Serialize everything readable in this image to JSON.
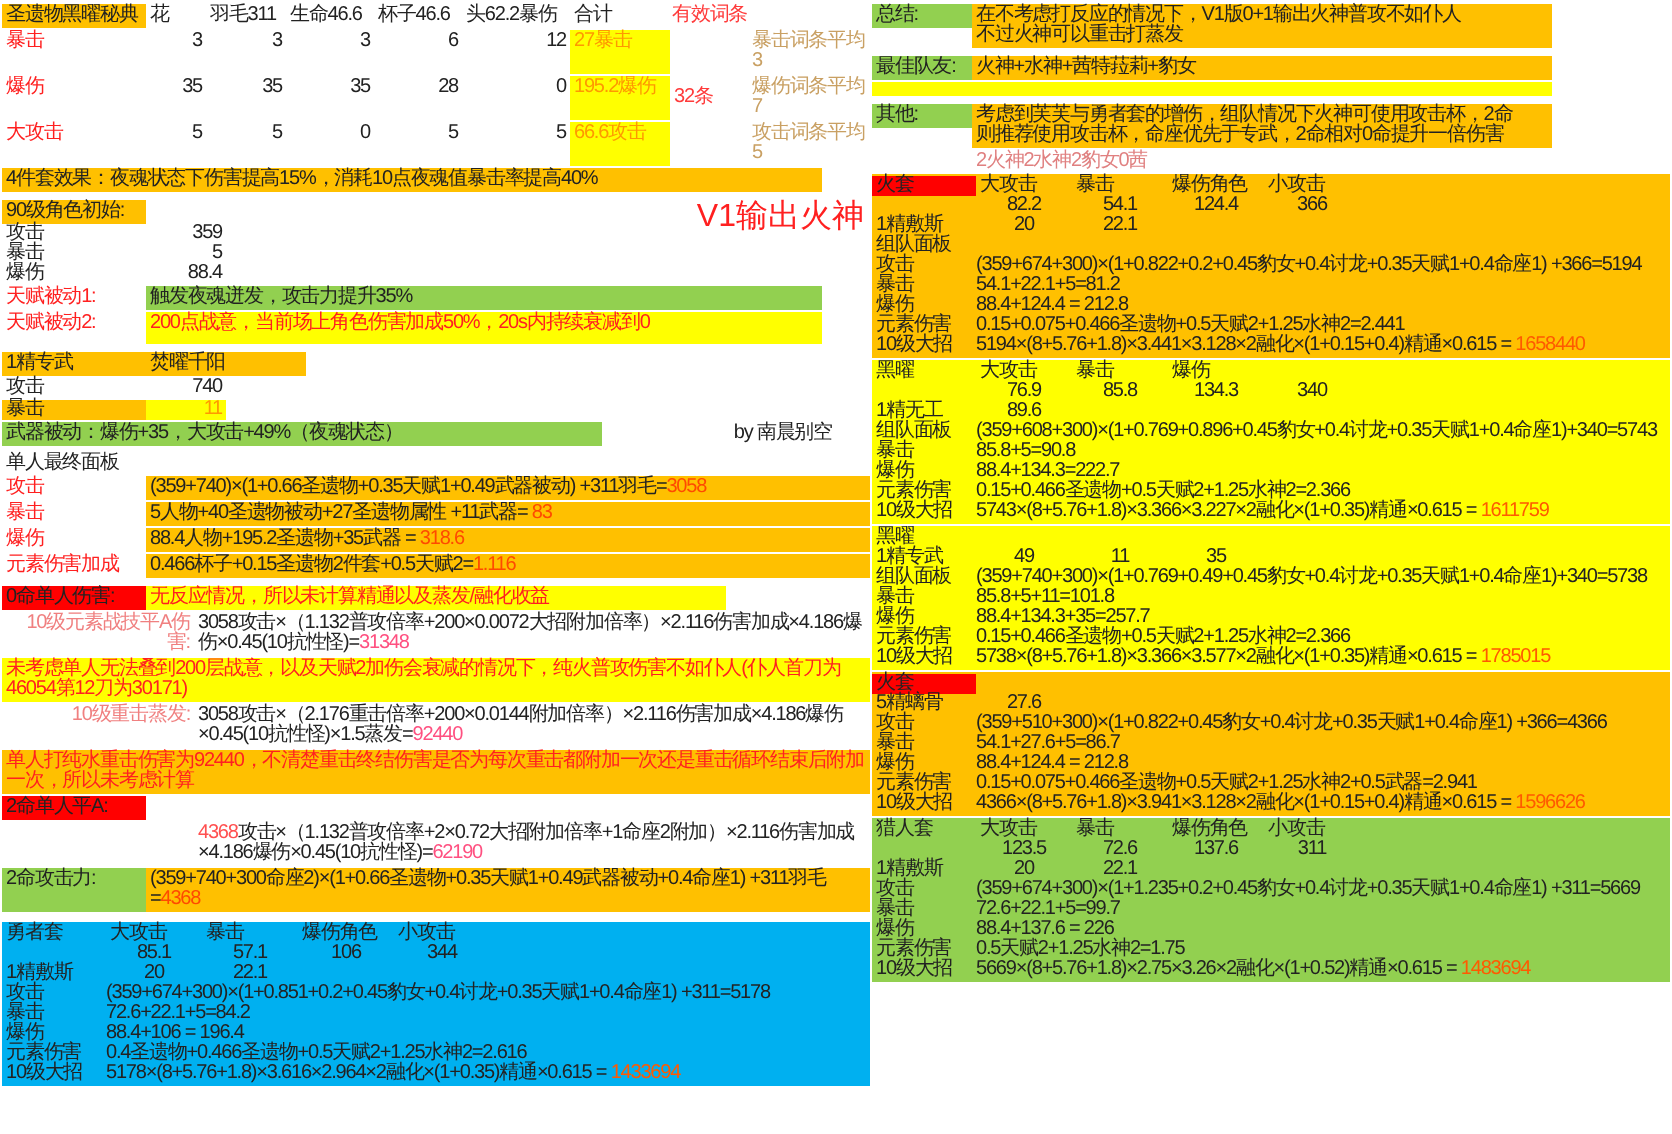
{
  "artifacts": {
    "columns": [
      "圣遗物黑曜秘典",
      "花",
      "羽毛311",
      "生命46.6",
      "杯子46.6",
      "头62.2暴伤",
      "合计",
      "有效词条"
    ],
    "rows": [
      {
        "stat": "暴击",
        "values": [
          "3",
          "3",
          "3",
          "6",
          "12"
        ],
        "total": "27暴击",
        "average": "暴击词条平均3"
      },
      {
        "stat": "爆伤",
        "values": [
          "35",
          "35",
          "35",
          "28",
          "0"
        ],
        "total": "195.2爆伤",
        "average": "爆伤词条平均7"
      },
      {
        "stat": "大攻击",
        "values": [
          "5",
          "5",
          "0",
          "5",
          "5"
        ],
        "total": "66.6攻击",
        "average": "攻击词条平均5"
      }
    ],
    "effective_count": "32条"
  },
  "set_effect": "4件套效果：夜魂状态下伤害提高15%，消耗10点夜魂值暴击率提高40%",
  "title": "V1输出火神",
  "base_stats": {
    "title": "90级角色初始:",
    "rows": [
      {
        "label": "攻击",
        "value": "359"
      },
      {
        "label": "暴击",
        "value": "5"
      },
      {
        "label": "爆伤",
        "value": "88.4"
      }
    ]
  },
  "talents": [
    {
      "label": "天赋被动1:",
      "text": "触发夜魂迸发，攻击力提升35%",
      "kind": "buff"
    },
    {
      "label": "天赋被动2:",
      "text": "200点战意，当前场上角色伤害加成50%，20s内持续衰减到0",
      "kind": "warning"
    }
  ],
  "weapon": {
    "refine": "1精专武",
    "name": "焚曜千阳",
    "rows": [
      {
        "label": "攻击",
        "value": "740",
        "highlighted": false
      },
      {
        "label": "暴击",
        "value": "11",
        "highlighted": true
      }
    ],
    "passive": "武器被动：爆伤+35，大攻击+49%（夜魂状态）",
    "credit": "by 南晨别空"
  },
  "solo_panel": {
    "title": "单人最终面板",
    "rows": [
      {
        "label": "攻击",
        "formula": "(359+740)×(1+0.66圣遗物+0.35天赋1+0.49武器被动) +311羽毛=",
        "result": "3058"
      },
      {
        "label": "暴击",
        "formula": "5人物+40圣遗物被动+27圣遗物属性 +11武器= ",
        "result": "83"
      },
      {
        "label": "爆伤",
        "formula": "88.4人物+195.2圣遗物+35武器 = ",
        "result": "318.6"
      },
      {
        "label": "元素伤害加成",
        "formula": "0.466杯子+0.15圣遗物2件套+0.5天赋2=",
        "result": "1.116"
      }
    ]
  },
  "damage": [
    {
      "kind": "heading",
      "label": "0命单人伤害:",
      "note": "无反应情况，所以未计算精通以及蒸发/融化收益"
    },
    {
      "kind": "calc",
      "label": "10级元素战技平A伤害:",
      "formula": "3058攻击×（1.132普攻倍率+200×0.0072大招附加倍率）×2.116伤害加成×4.186爆伤×0.45(10抗性怪)=",
      "result": "31348"
    },
    {
      "kind": "warning",
      "text": "未考虑单人无法叠到200层战意，以及天赋2加伤会衰减的情况下，纯火普攻伤害不如仆人(仆人首刀为46054第12刀为30171)"
    },
    {
      "kind": "calc",
      "label": "10级重击蒸发:",
      "formula": "3058攻击×（2.176重击倍率+200×0.0144附加倍率）×2.116伤害加成×4.186爆伤×0.45(10抗性怪)×1.5蒸发=",
      "result": "92440"
    },
    {
      "kind": "alert",
      "text": "单人打纯水重击伤害为92440，不清楚重击终结伤害是否为每次重击都附加一次还是重击循环结束后附加一次，所以未考虑计算"
    },
    {
      "kind": "heading",
      "label": "2命单人平A:"
    },
    {
      "kind": "calc",
      "lead": "4368",
      "formula": "攻击×（1.132普攻倍率+2×0.72大招附加倍率+1命座2附加）×2.116伤害加成×4.186爆伤×0.45(10抗性怪)=",
      "result": "62190"
    },
    {
      "kind": "total",
      "label": "2命攻击力:",
      "formula": "(359+740+300命座2)×(1+0.66圣遗物+0.35天赋1+0.49武器被动+0.4命座1) +311羽毛=",
      "result": "4368"
    }
  ],
  "summary": [
    {
      "label": "总结:",
      "lines": [
        "在不考虑打反应的情况下，V1版0+1输出火神普攻不如仆人",
        "不过火神可以重击打蒸发"
      ]
    },
    {
      "label": "最佳队友:",
      "lines": [
        "火神+水神+茜特菈莉+豹女"
      ]
    },
    {
      "label": "其他:",
      "lines": [
        "考虑到芙芙与勇者套的增伤，组队情况下火神可使用攻击杯，2命",
        "则推荐使用攻击杯，命座优先于专武，2命相对0命提升一倍伤害"
      ]
    }
  ],
  "team_note": "2火神2水神2豹女0茜",
  "builds": [
    {
      "set": "火套",
      "flagged": true,
      "color": "#ffc000",
      "headers": [
        "大攻击",
        "暴击",
        "爆伤角色",
        "小攻击"
      ],
      "values": [
        "82.2",
        "54.1",
        "124.4",
        "366"
      ],
      "weapon": {
        "name": "1精敷斯",
        "values": [
          "20",
          "22.1"
        ]
      },
      "panel_label": "组队面板",
      "rows": [
        {
          "label": "攻击",
          "formula": "(359+674+300)×(1+0.822+0.2+0.45豹女+0.4讨龙+0.35天赋1+0.4命座1) +366=5194"
        },
        {
          "label": "暴击",
          "formula": "54.1+22.1+5=81.2"
        },
        {
          "label": "爆伤",
          "formula": "88.4+124.4 = 212.8"
        },
        {
          "label": "元素伤害",
          "formula": "0.15+0.075+0.466圣遗物+0.5天赋2+1.25水神2=2.441"
        },
        {
          "label": "10级大招",
          "formula": "5194×(8+5.76+1.8)×3.441×3.128×2融化×(1+0.15+0.4)精通×0.615 = ",
          "result": "1658440"
        }
      ]
    },
    {
      "set": "黑曜",
      "flagged": false,
      "color": "#ffff00",
      "headers": [
        "大攻击",
        "暴击",
        "爆伤"
      ],
      "values": [
        "76.9",
        "85.8",
        "134.3",
        "340"
      ],
      "weapon": {
        "name": "1精无工",
        "values": [
          "89.6"
        ]
      },
      "rows": [
        {
          "label": "组队面板",
          "formula": "(359+608+300)×(1+0.769+0.896+0.45豹女+0.4讨龙+0.35天赋1+0.4命座1)+340=5743"
        },
        {
          "label": "暴击",
          "formula": "85.8+5=90.8"
        },
        {
          "label": "爆伤",
          "formula": "88.4+134.3=222.7"
        },
        {
          "label": "元素伤害",
          "formula": "0.15+0.466圣遗物+0.5天赋2+1.25水神2=2.366"
        },
        {
          "label": "10级大招",
          "formula": "5743×(8+5.76+1.8)×3.366×3.227×2融化×(1+0.35)精通×0.615 = ",
          "result": "1611759"
        }
      ]
    },
    {
      "set": "黑曜",
      "flagged": false,
      "color": "#ffff00",
      "weapon": {
        "name": "1精专武",
        "values": [
          "49",
          "11",
          "35"
        ]
      },
      "rows": [
        {
          "label": "组队面板",
          "formula": "(359+740+300)×(1+0.769+0.49+0.45豹女+0.4讨龙+0.35天赋1+0.4命座1)+340=5738"
        },
        {
          "label": "暴击",
          "formula": "85.8+5+11=101.8"
        },
        {
          "label": "爆伤",
          "formula": "88.4+134.3+35=257.7"
        },
        {
          "label": "元素伤害",
          "formula": "0.15+0.466圣遗物+0.5天赋2+1.25水神2=2.366"
        },
        {
          "label": "10级大招",
          "formula": "5738×(8+5.76+1.8)×3.366×3.577×2融化×(1+0.35)精通×0.615 = ",
          "result": "1785015"
        }
      ]
    },
    {
      "set": "火套",
      "flagged": true,
      "color": "#ffc000",
      "weapon": {
        "name": "5精螭骨",
        "values": [
          "27.6"
        ]
      },
      "rows": [
        {
          "label": "攻击",
          "formula": "(359+510+300)×(1+0.822+0.45豹女+0.4讨龙+0.35天赋1+0.4命座1) +366=4366"
        },
        {
          "label": "暴击",
          "formula": "54.1+27.6+5=86.7"
        },
        {
          "label": "爆伤",
          "formula": "88.4+124.4 = 212.8"
        },
        {
          "label": "元素伤害",
          "formula": "0.15+0.075+0.466圣遗物+0.5天赋2+1.25水神2+0.5武器=2.941"
        },
        {
          "label": "10级大招",
          "formula": "4366×(8+5.76+1.8)×3.941×3.128×2融化×(1+0.15+0.4)精通×0.615 = ",
          "result": "1596626"
        }
      ]
    },
    {
      "set": "猎人套",
      "flagged": false,
      "color": "#92d050",
      "headers": [
        "大攻击",
        "暴击",
        "爆伤角色",
        "小攻击"
      ],
      "values": [
        "123.5",
        "72.6",
        "137.6",
        "311"
      ],
      "weapon": {
        "name": "1精敷斯",
        "values": [
          "20",
          "22.1"
        ]
      },
      "rows": [
        {
          "label": "攻击",
          "formula": "(359+674+300)×(1+1.235+0.2+0.45豹女+0.4讨龙+0.35天赋1+0.4命座1) +311=5669"
        },
        {
          "label": "暴击",
          "formula": "72.6+22.1+5=99.7"
        },
        {
          "label": "爆伤",
          "formula": "88.4+137.6 = 226"
        },
        {
          "label": "元素伤害",
          "formula": "0.5天赋2+1.25水神2=1.75"
        },
        {
          "label": "10级大招",
          "formula": "5669×(8+5.76+1.8)×2.75×3.26×2融化×(1+0.52)精通×0.615 = ",
          "result": "1483694"
        }
      ]
    },
    {
      "set": "勇者套",
      "flagged": false,
      "color": "#00b0f0",
      "headers": [
        "大攻击",
        "暴击",
        "爆伤角色",
        "小攻击"
      ],
      "values": [
        "85.1",
        "57.1",
        "106",
        "344"
      ],
      "weapon": {
        "name": "1精敷斯",
        "values": [
          "20",
          "22.1"
        ]
      },
      "rows": [
        {
          "label": "攻击",
          "formula": "(359+674+300)×(1+0.851+0.2+0.45豹女+0.4讨龙+0.35天赋1+0.4命座1) +311=5178"
        },
        {
          "label": "暴击",
          "formula": "72.6+22.1+5=84.2"
        },
        {
          "label": "爆伤",
          "formula": "88.4+106 = 196.4"
        },
        {
          "label": "元素伤害",
          "formula": "0.4圣遗物+0.466圣遗物+0.5天赋2+1.25水神2=2.616"
        },
        {
          "label": "10级大招",
          "formula": "5178×(8+5.76+1.8)×3.616×2.964×2融化×(1+0.35)精通×0.615 = ",
          "result": "1433694"
        }
      ]
    }
  ]
}
